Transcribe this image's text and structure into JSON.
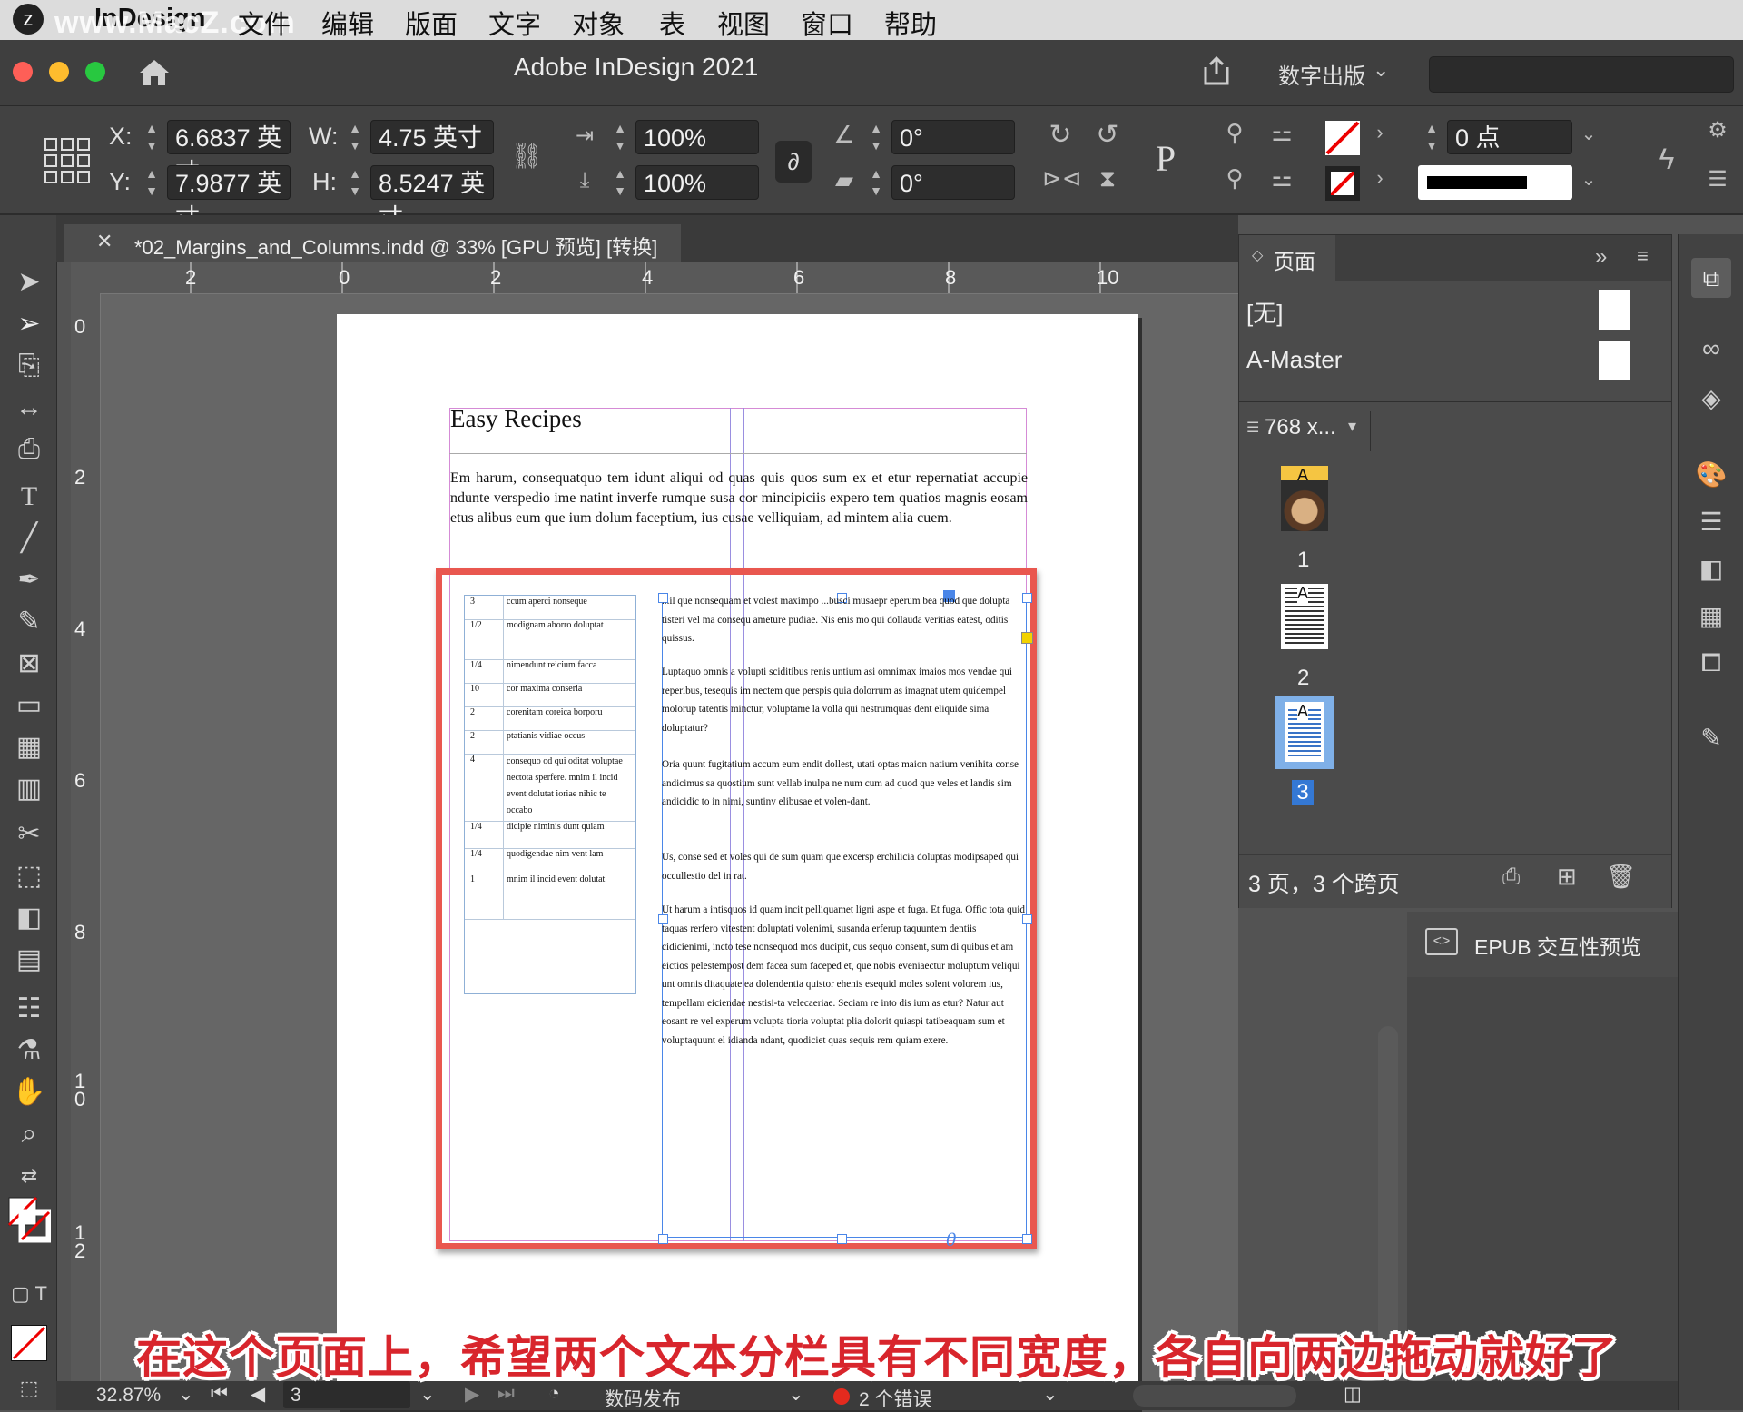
{
  "menubar": {
    "watermark": "www.MacZ.com",
    "app": "InDesign",
    "items": [
      "文件",
      "编辑",
      "版面",
      "文字",
      "对象",
      "表",
      "视图",
      "窗口",
      "帮助"
    ]
  },
  "titlebar": {
    "title": "Adobe InDesign 2021",
    "workspace": "数字出版"
  },
  "control": {
    "x_label": "X:",
    "x_value": "6.6837 英寸",
    "y_label": "Y:",
    "y_value": "7.9877 英寸",
    "w_label": "W:",
    "w_value": "4.75 英寸",
    "h_label": "H:",
    "h_value": "8.5247 英寸",
    "scale_x": "100%",
    "scale_y": "100%",
    "rotate": "0°",
    "shear": "0°",
    "stroke_weight": "0 点"
  },
  "document": {
    "tab_title": "*02_Margins_and_Columns.indd @ 33% [GPU 预览] [转换]",
    "hruler": [
      "2",
      "0",
      "2",
      "4",
      "6",
      "8",
      "10"
    ],
    "vruler": [
      "0",
      "2",
      "4",
      "6",
      "8",
      "1\n0",
      "1\n2"
    ]
  },
  "page_content": {
    "heading": "Easy Recipes",
    "intro": "Em harum, consequatquo tem idunt aliqui od quas quis quos sum ex et etur repernatiat accupie ndunte verspedio ime natint inverfe rumque susa cor mincipiciis expero tem quatios magnis eosam etus alibus eum que ium dolum faceptium, ius cusae velliquiam, ad mintem alia cuem.",
    "table": [
      [
        "3",
        "ccum aperci nonseque"
      ],
      [
        "1/2",
        "modignam aborro doluptat"
      ],
      [
        "1/4",
        "nimendunt reicium facca"
      ],
      [
        "10",
        "cor maxima conseria"
      ],
      [
        "2",
        "corenitam coreica borporu"
      ],
      [
        "2",
        "ptatianis vidiae occus"
      ],
      [
        "4",
        "consequo od qui oditat voluptae nectota sperfere. mnim il incid event dolutat ioriae nihic te occabo"
      ],
      [
        "1/4",
        "dicipie niminis dunt quiam"
      ],
      [
        "1/4",
        "quodigendae nim vent lam"
      ],
      [
        "1",
        "mnim il incid event dolutat"
      ]
    ],
    "paragraphs": [
      "...il que nonsequam et volest maximpo ...busci musaepr eperum bea quod que dolupta tisteri vel ma consequ ameture pudiae. Nis enis mo qui dollauda veritias eatest, oditis quissus.",
      "Luptaquo omnis a volupti sciditibus renis untium asi omnimax imaios mos vendae qui reperibus, tesequis im nectem que perspis quia dolorrum as imagnat utem quidempel molorup tatentis minctur, voluptame la volla qui nestrumquas dent eliquide sima doluptatur?",
      "Oria quunt fugitatium accum eum endit dollest, utati optas maion natium venihita conse andicimus sa quostium sunt vellab inulpa ne num cum ad quod que veles et landis sim andicidic to in nimi, suntinv elibusae et volen-dant.",
      "Us, conse sed et voles qui de sum quam que excersp erchilicia doluptas modipsaped qui occullestio del in rat.",
      "Ut harum a intisquos id quam incit pelliquamet ligni aspe et fuga. Et fuga. Offic tota quid taquas rerfero vitestent doluptati volenimi, susanda erferup taquuntem dentiis cidicienimi, incto tese nonsequod mos ducipit, cus sequo consent, sum di quibus et am eictios pelestempost dem facea sum faceped et, que nobis eveniaectur moluptum veliqui unt omnis ditaquate ea dolendentia quistor ehenis esequid moles solent volorem ius, tempellam eiciendae nestisi-ta velecaeriae. Seciam re into dis ium as etur? Natur aut eosant re vel experum volupta tioria voluptat plia dolorit quiaspi tatibeaquam sum et voluptaquunt el idianda ndant, quodiciet quas sequis rem quiam exere."
    ]
  },
  "pages_panel": {
    "title": "页面",
    "none_master": "[无]",
    "a_master": "A-Master",
    "size": "768 x...",
    "pages": [
      "1",
      "2",
      "3"
    ],
    "footer": "3 页，3 个跨页"
  },
  "epub_panel": {
    "label": "EPUB 交互性预览"
  },
  "statusbar": {
    "zoom": "32.87%",
    "page": "3",
    "profile": "数码发布",
    "errors": "2 个错误"
  },
  "subtitle": "在这个页面上，希望两个文本分栏具有不同宽度，各自向两边拖动就好了",
  "colors": {
    "highlight_frame": "#e9574f",
    "selection": "#4a86e8",
    "subtitle": "#d8252c"
  }
}
